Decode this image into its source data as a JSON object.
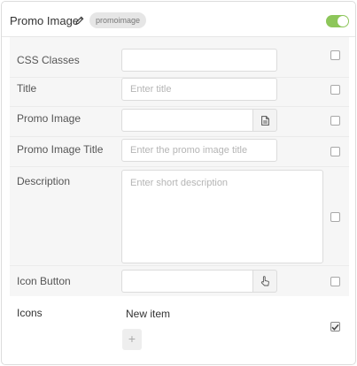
{
  "header": {
    "title": "Promo Image",
    "tag": "promoimage",
    "enabled": true
  },
  "fields": {
    "css_classes": {
      "label": "CSS Classes",
      "value": "",
      "placeholder": ""
    },
    "title": {
      "label": "Title",
      "value": "",
      "placeholder": "Enter title"
    },
    "promo_image": {
      "label": "Promo Image",
      "value": ""
    },
    "promo_image_title": {
      "label": "Promo Image Title",
      "value": "",
      "placeholder": "Enter the promo image title"
    },
    "description": {
      "label": "Description",
      "value": "",
      "placeholder": "Enter short description"
    },
    "icon_button": {
      "label": "Icon Button",
      "value": ""
    }
  },
  "icons": {
    "label": "Icons",
    "items": [
      "New item"
    ],
    "add_label": "+"
  },
  "icons_meta": {
    "edit": "pencil-icon",
    "file": "file-icon",
    "pointer": "hand-pointer-icon",
    "check": "check-icon"
  },
  "colors": {
    "toggle_on": "#8dc65a"
  }
}
